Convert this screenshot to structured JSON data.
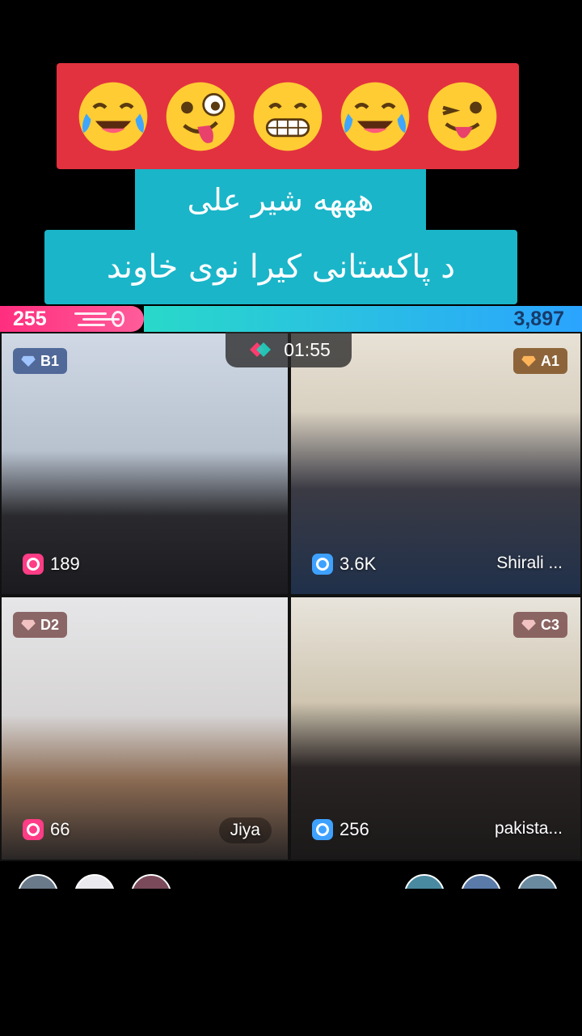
{
  "caption": {
    "line1": "هههه شیر علی",
    "line2": "د پاکستانی کیرا نوی خاوند"
  },
  "emojis": [
    "face-with-tears-of-joy-icon",
    "zany-face-icon",
    "grinning-face-icon",
    "face-with-tears-of-joy-icon",
    "winking-face-with-tongue-icon"
  ],
  "battle": {
    "left_score": "255",
    "right_score": "3,897",
    "timer": "01:55"
  },
  "participants": [
    {
      "rank": "B1",
      "count": "189",
      "name": ""
    },
    {
      "rank": "A1",
      "count": "3.6K",
      "name": "Shirali ..."
    },
    {
      "rank": "D2",
      "count": "66",
      "name": "Jiya"
    },
    {
      "rank": "C3",
      "count": "256",
      "name": "pakista..."
    }
  ],
  "colors": {
    "banner_red": "#e2323f",
    "caption_teal": "#1ab5c9",
    "team_pink": "#ff2e7e",
    "team_blue": "#2aa4ff"
  }
}
